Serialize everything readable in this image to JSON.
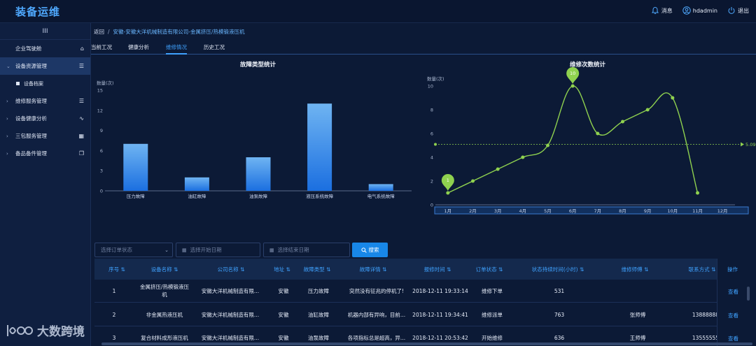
{
  "app": {
    "title": "装备运维"
  },
  "header": {
    "actions": [
      {
        "label": "消息",
        "icon": "bell-icon"
      },
      {
        "label": "hdadmin",
        "icon": "user-icon"
      },
      {
        "label": "退出",
        "icon": "power-icon"
      }
    ]
  },
  "sidebar": {
    "collapse_label": "III",
    "items": [
      {
        "label": "企业驾驶舱",
        "icon": "home-icon"
      },
      {
        "label": "设备资源管理",
        "icon": "list-icon",
        "expanded": true
      },
      {
        "label": "设备档案",
        "icon": "square-icon"
      },
      {
        "label": "维修服务管理",
        "icon": "list-icon"
      },
      {
        "label": "设备健康分析",
        "icon": "line-chart-icon"
      },
      {
        "label": "三包服务管理",
        "icon": "grid-icon"
      },
      {
        "label": "备品备件管理",
        "icon": "copy-icon"
      }
    ]
  },
  "breadcrumb": {
    "back": "返回",
    "sep": "/",
    "path": "安徽-安徽大洋机械制造有限公司-金属挤压/热模锻液压机"
  },
  "tabs": [
    "当前工况",
    "健康分析",
    "维修情况",
    "历史工况"
  ],
  "active_tab": "维修情况",
  "charts": [
    {
      "type": "bar",
      "title": "故障类型统计",
      "ylabel": "数量(次)",
      "categories": [
        "压力故障",
        "油缸故障",
        "油泵故障",
        "液压系统故障",
        "电气系统故障"
      ],
      "values": [
        7,
        2,
        5,
        13,
        1
      ],
      "yticks": [
        0,
        3,
        6,
        9,
        12,
        15
      ],
      "ylim": [
        0,
        15
      ],
      "color": "#3b8fe8"
    },
    {
      "type": "line",
      "title": "维修次数统计",
      "ylabel": "数量(次)",
      "categories": [
        "1月",
        "2月",
        "3月",
        "4月",
        "5月",
        "6月",
        "7月",
        "8月",
        "9月",
        "10月",
        "11月",
        "12月"
      ],
      "values": [
        1,
        2,
        3,
        4,
        5,
        10,
        6,
        7,
        8,
        9,
        1
      ],
      "yticks": [
        0,
        2,
        4,
        6,
        8,
        10
      ],
      "ylim": [
        0,
        10
      ],
      "markline": {
        "value": 5.09,
        "label": "5.09"
      },
      "max_label": "10",
      "min_label": "1",
      "color": "#8fd14f"
    }
  ],
  "filters": {
    "status_placeholder": "选择订单状态",
    "start_placeholder": "选择开始日期",
    "end_placeholder": "选择结束日期",
    "search_label": "搜索"
  },
  "table": {
    "headers": [
      "序号",
      "设备名称",
      "公司名称",
      "地址",
      "故障类型",
      "故障详情",
      "报修时间",
      "订单状态",
      "状态持续时间(小时)",
      "维修师傅",
      "联系方式",
      "操作"
    ],
    "rows": [
      [
        "1",
        "金属挤压/热模锻液压\n机",
        "安徽大洋机械制造有限...",
        "安徽",
        "压力故障",
        "突然没有征兆的停机了!",
        "2018-12-11 19:33:14",
        "维修下单",
        "531",
        "",
        "",
        "查看"
      ],
      [
        "2",
        "非金属热液压机",
        "安徽大洋机械制造有限...",
        "安徽",
        "油缸故障",
        "机器内部有异响，目前...",
        "2018-12-11 19:34:41",
        "维修派单",
        "763",
        "张师傅",
        "13888888",
        "查看"
      ],
      [
        "3",
        "复合材料成形液压机",
        "安徽大洋机械制造有限...",
        "安徽",
        "油泵故障",
        "各项指标总是超高，异...",
        "2018-12-11 20:53:42",
        "开始维修",
        "636",
        "王师傅",
        "13555555",
        "查看"
      ]
    ]
  },
  "watermark": {
    "text": "大数跨境"
  }
}
